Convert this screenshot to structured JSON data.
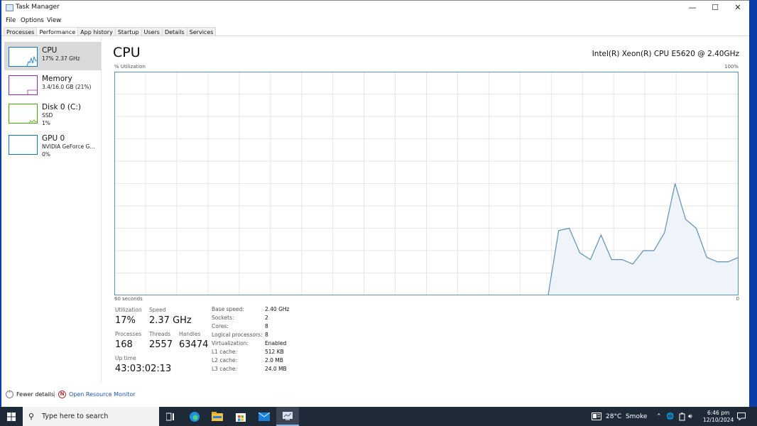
{
  "window": {
    "title": "Task Manager",
    "controls": {
      "minimize": "—",
      "maximize": "☐",
      "close": "✕"
    }
  },
  "menu": [
    "File",
    "Options",
    "View"
  ],
  "tabs": [
    {
      "label": "Processes",
      "active": false
    },
    {
      "label": "Performance",
      "active": true
    },
    {
      "label": "App history",
      "active": false
    },
    {
      "label": "Startup",
      "active": false
    },
    {
      "label": "Users",
      "active": false
    },
    {
      "label": "Details",
      "active": false
    },
    {
      "label": "Services",
      "active": false
    }
  ],
  "sidebar": {
    "items": [
      {
        "name": "CPU",
        "line1": "17% 2.37 GHz",
        "line2": "",
        "color": "#1779ba",
        "active": true
      },
      {
        "name": "Memory",
        "line1": "3.4/16.0 GB (21%)",
        "line2": "",
        "color": "#8b2fa8",
        "active": false
      },
      {
        "name": "Disk 0 (C:)",
        "line1": "SSD",
        "line2": "1%",
        "color": "#4da60c",
        "active": false
      },
      {
        "name": "GPU 0",
        "line1": "NVIDIA GeForce G...",
        "line2": "0%",
        "color": "#1779ba",
        "active": false
      }
    ]
  },
  "cpu": {
    "title": "CPU",
    "model": "Intel(R) Xeon(R) CPU E5620 @ 2.40GHz",
    "graph_label": "% Utilization",
    "max_label": "100%",
    "time_label": "60 seconds",
    "zero_label": "0",
    "stats": {
      "utilization_label": "Utilization",
      "utilization": "17%",
      "speed_label": "Speed",
      "speed": "2.37 GHz",
      "processes_label": "Processes",
      "processes": "168",
      "threads_label": "Threads",
      "threads": "2557",
      "handles_label": "Handles",
      "handles": "63474",
      "uptime_label": "Up time",
      "uptime": "43:03:02:13"
    },
    "details": [
      {
        "key": "Base speed:",
        "value": "2.40 GHz"
      },
      {
        "key": "Sockets:",
        "value": "2"
      },
      {
        "key": "Cores:",
        "value": "8"
      },
      {
        "key": "Logical processors:",
        "value": "8"
      },
      {
        "key": "Virtualization:",
        "value": "Enabled"
      },
      {
        "key": "L1 cache:",
        "value": "512 KB"
      },
      {
        "key": "L2 cache:",
        "value": "2.0 MB"
      },
      {
        "key": "L3 cache:",
        "value": "24.0 MB"
      }
    ]
  },
  "chart_data": {
    "type": "area",
    "title": "CPU",
    "ylabel": "% Utilization",
    "xlabel": "60 seconds",
    "ylim": [
      0,
      100
    ],
    "xlim": [
      60,
      0
    ],
    "grid": true,
    "line_color": "#5f8fb4",
    "fill_color": "#eef4fa",
    "values": [
      0,
      0,
      0,
      0,
      0,
      0,
      0,
      0,
      0,
      0,
      0,
      0,
      0,
      0,
      0,
      0,
      0,
      0,
      0,
      0,
      0,
      0,
      0,
      0,
      0,
      0,
      0,
      0,
      0,
      0,
      0,
      0,
      0,
      0,
      0,
      0,
      0,
      0,
      0,
      0,
      0,
      0,
      29,
      30,
      19,
      16,
      27,
      16,
      16,
      14,
      20,
      20,
      28,
      50,
      34,
      30,
      17,
      15,
      15,
      17
    ]
  },
  "footer": {
    "fewer_details": "Fewer details",
    "open_resource_monitor": "Open Resource Monitor"
  },
  "taskbar": {
    "search_placeholder": "Type here to search",
    "weather": "28°C  Smoke",
    "time": "6:46 pm",
    "date": "12/10/2024"
  }
}
